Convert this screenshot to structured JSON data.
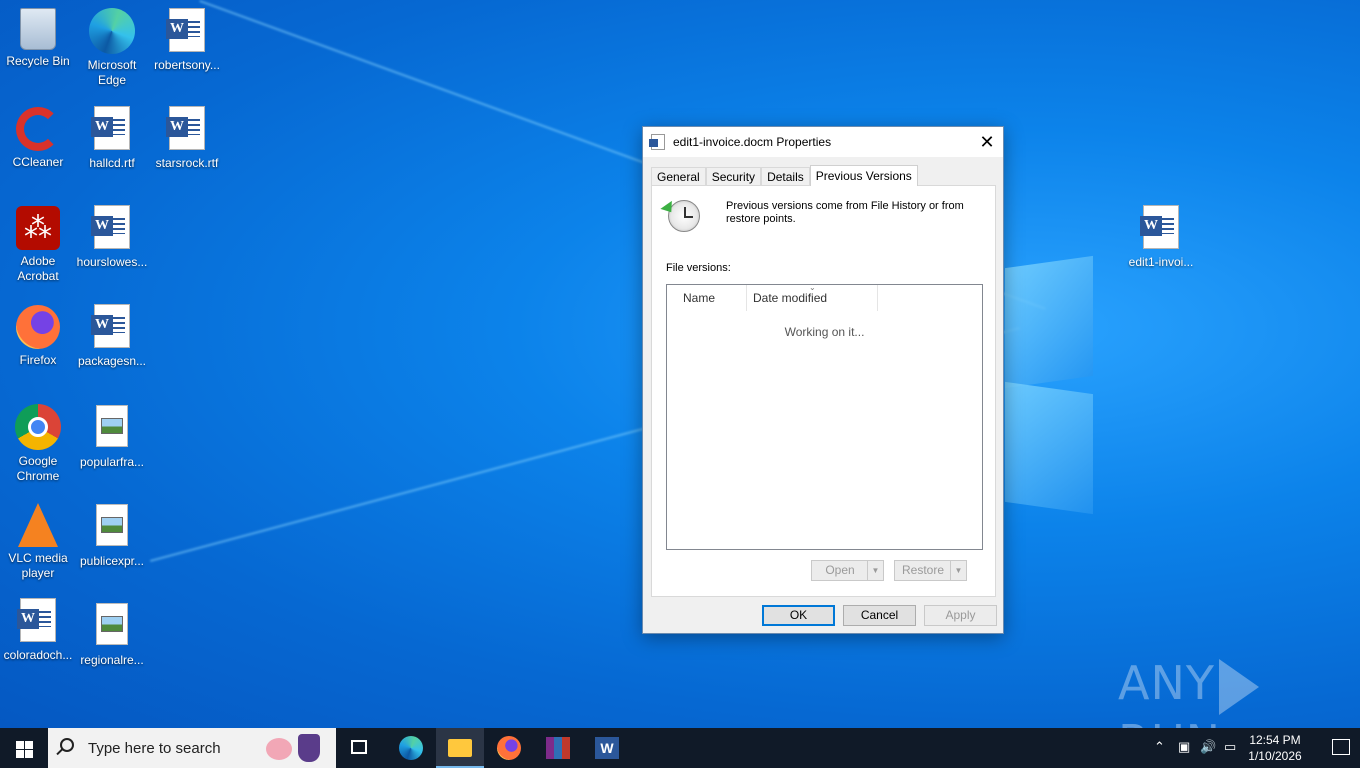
{
  "desktop": {
    "icons_col1": [
      "Recycle Bin",
      "CCleaner",
      "Adobe Acrobat",
      "Firefox",
      "Google Chrome",
      "VLC media player",
      "coloradoch..."
    ],
    "icons_col2": [
      "Microsoft Edge",
      "hallcd.rtf",
      "hourslowes...",
      "packagesn...",
      "popularfra...",
      "publicexpr...",
      "regionalre..."
    ],
    "icons_col3": [
      "robertsony...",
      "starsrock.rtf"
    ],
    "right_icon": "edit1-invoi..."
  },
  "dialog": {
    "title": "edit1-invoice.docm Properties",
    "close": "✕",
    "tabs": [
      "General",
      "Security",
      "Details",
      "Previous Versions"
    ],
    "active_tab": "Previous Versions",
    "info": "Previous versions come from File History or from restore points.",
    "file_versions_label": "File versions:",
    "columns": [
      "Name",
      "Date modified"
    ],
    "status": "Working on it...",
    "open_label": "Open",
    "restore_label": "Restore",
    "ok_label": "OK",
    "cancel_label": "Cancel",
    "apply_label": "Apply"
  },
  "watermark": {
    "left": "ANY",
    "right": "RUN"
  },
  "taskbar": {
    "search_placeholder": "Type here to search",
    "time": "12:54 PM",
    "date": "1/10/2026"
  }
}
